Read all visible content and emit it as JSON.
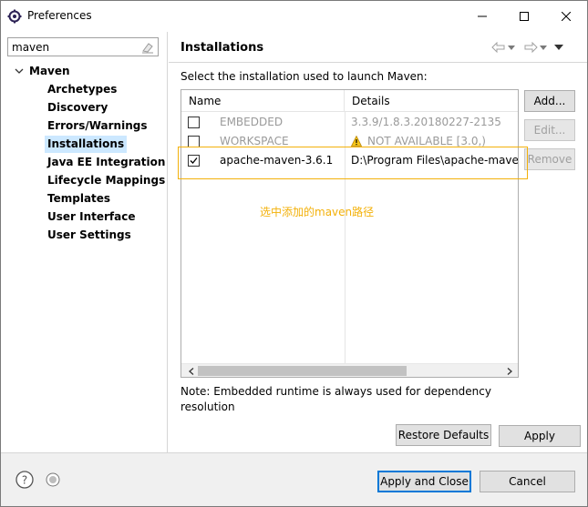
{
  "window": {
    "title": "Preferences",
    "controls": {
      "minimize": "minimize",
      "maximize": "maximize",
      "close": "close"
    }
  },
  "filter": {
    "value": "maven"
  },
  "tree": {
    "root": "Maven",
    "items": [
      {
        "label": "Archetypes",
        "selected": false
      },
      {
        "label": "Discovery",
        "selected": false
      },
      {
        "label": "Errors/Warnings",
        "selected": false
      },
      {
        "label": "Installations",
        "selected": true
      },
      {
        "label": "Java EE Integration",
        "selected": false
      },
      {
        "label": "Lifecycle Mappings",
        "selected": false
      },
      {
        "label": "Templates",
        "selected": false
      },
      {
        "label": "User Interface",
        "selected": false
      },
      {
        "label": "User Settings",
        "selected": false
      }
    ]
  },
  "page": {
    "title": "Installations",
    "instructions": "Select the installation used to launch Maven:",
    "table": {
      "columns": {
        "name": "Name",
        "details": "Details"
      },
      "rows": [
        {
          "checked": false,
          "disabled": true,
          "name": "EMBEDDED",
          "details": "3.3.9/1.8.3.20180227-2135",
          "warning": false
        },
        {
          "checked": false,
          "disabled": true,
          "name": "WORKSPACE",
          "details": "NOT AVAILABLE [3.0,)",
          "warning": true
        },
        {
          "checked": true,
          "disabled": false,
          "name": "apache-maven-3.6.1",
          "details": "D:\\Program Files\\apache-maven",
          "warning": false
        }
      ]
    },
    "buttons": {
      "add": "Add...",
      "edit": "Edit...",
      "remove": "Remove"
    },
    "annotation": "选中添加的maven路径",
    "note": "Note: Embedded runtime is always used for dependency resolution",
    "restore_defaults": "Restore Defaults",
    "apply": "Apply"
  },
  "footer": {
    "apply_and_close": "Apply and Close",
    "cancel": "Cancel"
  },
  "colors": {
    "selection": "#cce8ff",
    "annotation": "#f3b10a",
    "default_button_border": "#0078d7"
  }
}
